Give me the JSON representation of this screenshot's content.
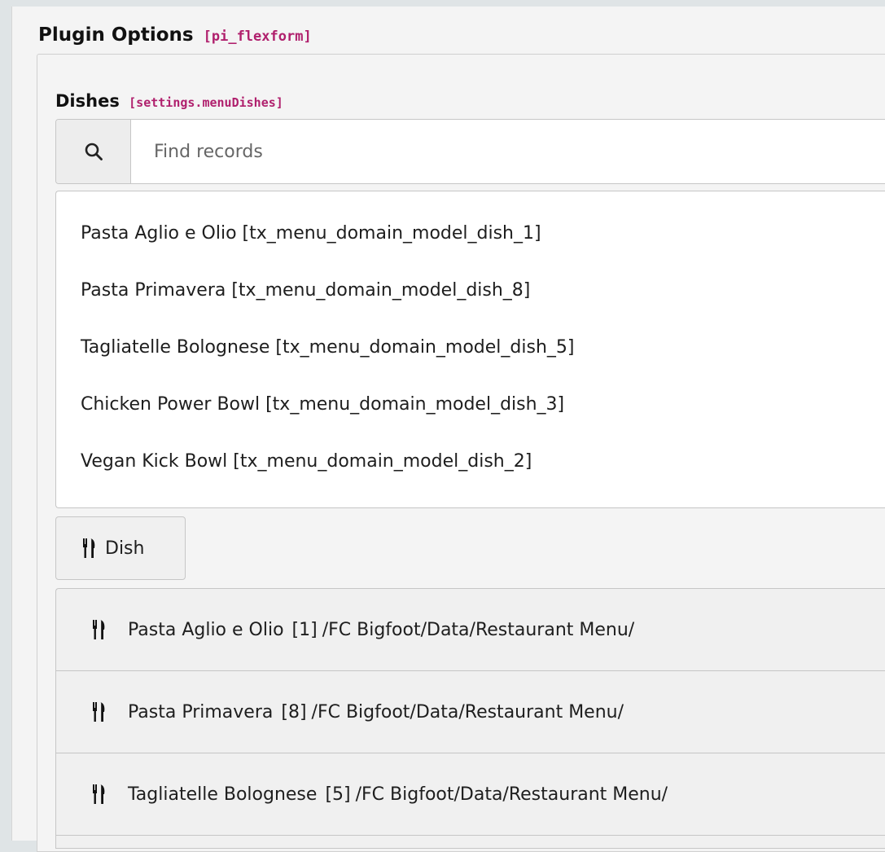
{
  "header": {
    "title": "Plugin Options",
    "tag": "[pi_flexform]"
  },
  "field": {
    "title": "Dishes",
    "tag": "[settings.menuDishes]"
  },
  "search": {
    "placeholder": "Find records",
    "icon": "search-icon"
  },
  "results": [
    {
      "label": "Pasta Aglio e Olio [tx_menu_domain_model_dish_1]"
    },
    {
      "label": "Pasta Primavera [tx_menu_domain_model_dish_8]"
    },
    {
      "label": "Tagliatelle Bolognese [tx_menu_domain_model_dish_5]"
    },
    {
      "label": "Chicken Power Bowl [tx_menu_domain_model_dish_3]"
    },
    {
      "label": "Vegan Kick Bowl [tx_menu_domain_model_dish_2]"
    }
  ],
  "add_button": {
    "label": "Dish",
    "icon": "cutlery-icon"
  },
  "selected": [
    {
      "name": "Pasta Aglio e Olio",
      "uid": "[1]",
      "path": "/FC Bigfoot/Data/Restaurant Menu/"
    },
    {
      "name": "Pasta Primavera",
      "uid": "[8]",
      "path": "/FC Bigfoot/Data/Restaurant Menu/"
    },
    {
      "name": "Tagliatelle Bolognese",
      "uid": "[5]",
      "path": "/FC Bigfoot/Data/Restaurant Menu/"
    }
  ],
  "colors": {
    "tag": "#b0206d",
    "background": "#f4f4f4",
    "border": "#c6c6c6"
  }
}
